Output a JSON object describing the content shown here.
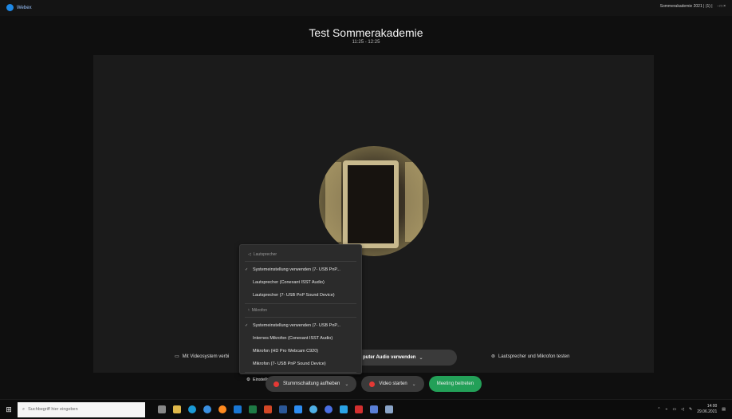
{
  "window": {
    "app_name": "Webex",
    "right_title": "Sommerakademie 2021 | (1) |",
    "controls": "- □ ×"
  },
  "meeting": {
    "title": "Test Sommerakademie",
    "time": "11:25 - 12:25"
  },
  "audio_menu": {
    "speaker_header": "Lautsprecher",
    "speakers": [
      {
        "label": "Systemeinstellung verwenden (7- USB PnP...",
        "selected": true
      },
      {
        "label": "Lautsprecher (Conexant ISST Audio)",
        "selected": false
      },
      {
        "label": "Lautsprecher (7- USB PnP Sound Device)",
        "selected": false
      }
    ],
    "mic_header": "Mikrofon",
    "mics": [
      {
        "label": "Systemeinstellung verwenden (7- USB PnP...",
        "selected": true
      },
      {
        "label": "Internes Mikrofon (Conexant ISST Audio)",
        "selected": false
      },
      {
        "label": "Mikrofon (HD Pro Webcam C920)",
        "selected": false
      },
      {
        "label": "Mikrofon (7- USB PnP Sound Device)",
        "selected": false
      }
    ],
    "settings": "Einstellungen..."
  },
  "controls_row": {
    "video_system": "Mit Videosystem verbi",
    "audio_pill": "puter Audio verwenden",
    "test_audio": "Lautsprecher und Mikrofon testen"
  },
  "actions": {
    "unmute": "Stummschaltung aufheben",
    "video": "Video starten",
    "join": "Meeting beitreten"
  },
  "taskbar": {
    "search_placeholder": "Suchbegriff hier eingeben",
    "time": "14:00",
    "date": "29.06.2021"
  },
  "colors": {
    "accent_green": "#23a058",
    "muted_red": "#e53935",
    "hint_arrow": "#5b8fd6"
  },
  "taskbar_icons": [
    "task-view",
    "file-explorer",
    "edge",
    "ie",
    "firefox",
    "outlook",
    "excel",
    "powerpoint",
    "word",
    "onenote",
    "chrome",
    "teams",
    "vpn",
    "acrobat",
    "snip",
    "webex"
  ]
}
